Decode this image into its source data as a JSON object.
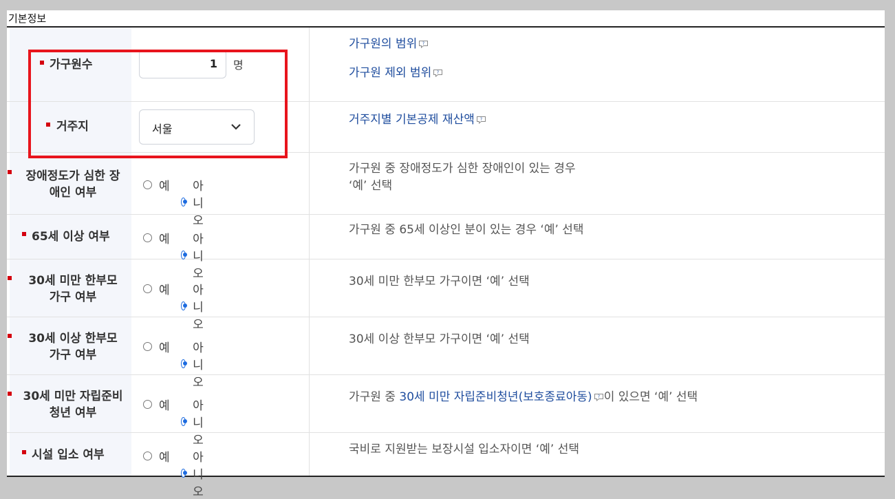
{
  "section": {
    "title": "기본정보"
  },
  "household": {
    "label": "가구원수",
    "value": "1",
    "unit": "명",
    "links": [
      "가구원의 범위",
      "가구원 제외 범위"
    ]
  },
  "residence": {
    "label": "거주지",
    "selected": "서울",
    "link": "거주지별 기본공제 재산액"
  },
  "radio_options": {
    "yes": "예",
    "no": "아니오",
    "selected": "no"
  },
  "rows": [
    {
      "label_1": "장애정도가 심한 장",
      "label_2": "애인 여부",
      "desc_1": "가구원 중 장애정도가 심한 장애인이 있는 경우",
      "desc_2": "‘예’ 선택"
    },
    {
      "label_1": "65세 이상 여부",
      "desc_1": "가구원 중 65세 이상인 분이 있는 경우 ‘예’ 선택"
    },
    {
      "label_1": "30세 미만 한부모",
      "label_2": "가구 여부",
      "desc_1": "30세 미만 한부모 가구이면 ‘예’ 선택"
    },
    {
      "label_1": "30세 이상 한부모",
      "label_2": "가구 여부",
      "desc_1": "30세 이상 한부모 가구이면 ‘예’ 선택"
    },
    {
      "label_1": "30세 미만 자립준비",
      "label_2": "청년 여부",
      "desc_prefix": "가구원 중 ",
      "desc_link": "30세 미만 자립준비청년(보호종료아동)",
      "desc_suffix": "이 있으면 ‘예’ 선택"
    },
    {
      "label_1": "시설 입소 여부",
      "desc_1": "국비로 지원받는 보장시설 입소자이면 ‘예’ 선택"
    }
  ],
  "colors": {
    "required_marker": "#d4000f",
    "link": "#1f4d9e",
    "radio_selected": "#1c6be0",
    "highlight": "#e8141c"
  }
}
